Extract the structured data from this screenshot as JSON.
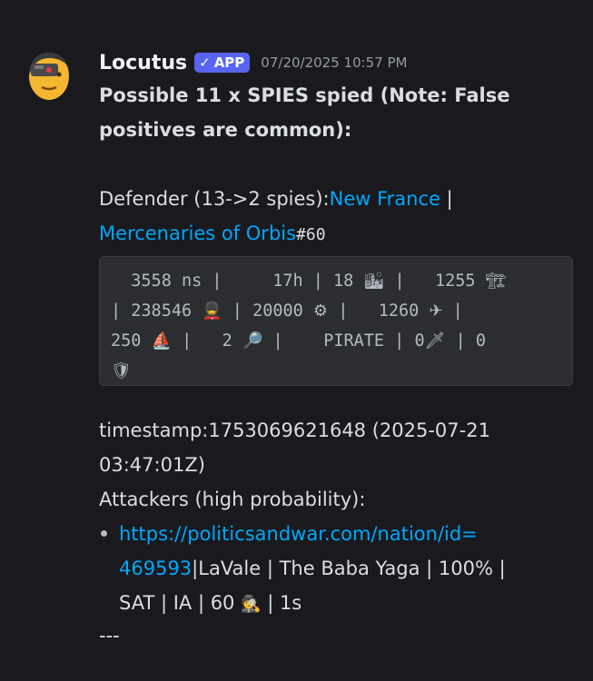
{
  "message": {
    "username": "Locutus",
    "badge_check": "✓",
    "badge_label": "APP",
    "timestamp": "07/20/2025 10:57 PM",
    "title_line1": "Possible 11 x SPIES spied (Note: False",
    "title_line2": "positives are common):",
    "defender_prefix": "Defender (13->2 spies):",
    "defender_nation": "New France",
    "separator": " |",
    "defender_alliance": "Mercenaries of Orbis",
    "defender_rank": "#60",
    "code": {
      "line1_a": "  3558 ns |     17h | 18 ",
      "line1_e1": "🏙",
      "line1_b": " |   1255 ",
      "line1_e2": "🏗",
      "line2_a": "| 238546 ",
      "line2_e1": "💂",
      "line2_b": " | 20000 ",
      "line2_e2": "⚙",
      "line2_c": " |   1260 ",
      "line2_e3": "✈",
      "line2_d": " |",
      "line3_a": "250 ",
      "line3_e1": "⛵",
      "line3_b": " |   2 ",
      "line3_e2": "🔎",
      "line3_c": " |    PIRATE | 0",
      "line3_e3": "🗡",
      "line3_d": " | 0",
      "line4_e1": "🛡"
    },
    "timestamp_line1": "timestamp:1753069621648 (2025-07-21",
    "timestamp_line2": "03:47:01Z)",
    "attackers_heading": "Attackers (high probability):",
    "attacker_link_line1": "https://politicsandwar.com/nation/id=",
    "attacker_link_line2": "469593",
    "attacker_rest_line2": "|LaVale | The Baba Yaga | 100% |",
    "attacker_line3": "SAT | IA | 60 ",
    "attacker_emoji": "🕵",
    "attacker_line3_end": " | 1s",
    "footer": "---"
  },
  "colors": {
    "background": "#1a1a1e",
    "text": "#dbdee1",
    "link": "#00a8fc",
    "badge": "#5865f2",
    "muted": "#949ba4",
    "codeblock_bg": "#2b2d31"
  }
}
